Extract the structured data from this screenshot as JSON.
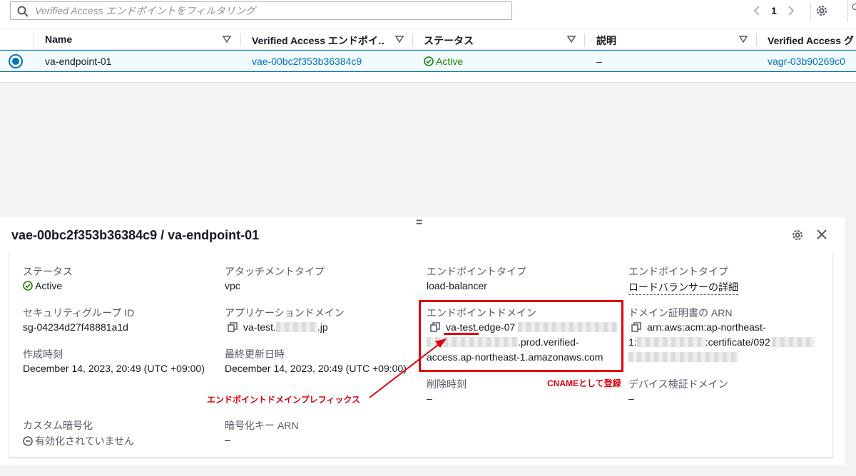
{
  "filter": {
    "placeholder": "Verified Access エンドポイントをフィルタリング"
  },
  "pagination": {
    "current_page": "1"
  },
  "right_edge_char": "C",
  "table": {
    "columns": [
      "Name",
      "Verified Access エンドポイ…",
      "ステータス",
      "説明",
      "Verified Access グ"
    ],
    "row": {
      "name": "va-endpoint-01",
      "endpoint_id": "vae-00bc2f353b36384c9",
      "status": "Active",
      "description": "–",
      "group_id": "vagr-03b90269c0"
    }
  },
  "panel": {
    "title": "vae-00bc2f353b36384c9 / va-endpoint-01",
    "resize_handle": "="
  },
  "details": {
    "status_label": "ステータス",
    "status_value": "Active",
    "attachment_type_label": "アタッチメントタイプ",
    "attachment_type_value": "vpc",
    "endpoint_type_label": "エンドポイントタイプ",
    "endpoint_type_value": "load-balancer",
    "endpoint_type2_label": "エンドポイントタイプ",
    "endpoint_type2_value": "ロードバランサーの詳細",
    "sg_label": "セキュリティグループ ID",
    "sg_value": "sg-04234d27f48881a1d",
    "app_domain_label": "アプリケーションドメイン",
    "app_domain_prefix": "va-test.",
    "app_domain_suffix": ".jp",
    "endpoint_domain_label": "エンドポイントドメイン",
    "endpoint_domain_line1": "va-test.edge-07",
    "endpoint_domain_line2": ".prod.verified-",
    "endpoint_domain_line3": "access.ap-northeast-1.amazonaws.com",
    "cert_label": "ドメイン証明書の ARN",
    "cert_line1": "arn:aws:acm:ap-northeast-",
    "cert_line2a": "1:",
    "cert_line2b": ":certificate/092",
    "created_label": "作成時刻",
    "created_value": "December 14, 2023, 20:49 (UTC +09:00)",
    "updated_label": "最終更新日時",
    "updated_value": "December 14, 2023, 20:49 (UTC +09:00)",
    "deleted_label": "削除時刻",
    "deleted_value": "–",
    "device_domain_label": "デバイス検証ドメイン",
    "device_domain_value": "–",
    "custom_enc_label": "カスタム暗号化",
    "custom_enc_value": "有効化されていません",
    "kms_label": "暗号化キー ARN",
    "kms_value": "–"
  },
  "annotations": {
    "prefix_note": "エンドポイントドメインプレフィックス",
    "cname_note": "CNAMEとして登録"
  },
  "colors": {
    "link": "#0073bb",
    "active": "#1d8102",
    "annotation": "#e0000f"
  }
}
